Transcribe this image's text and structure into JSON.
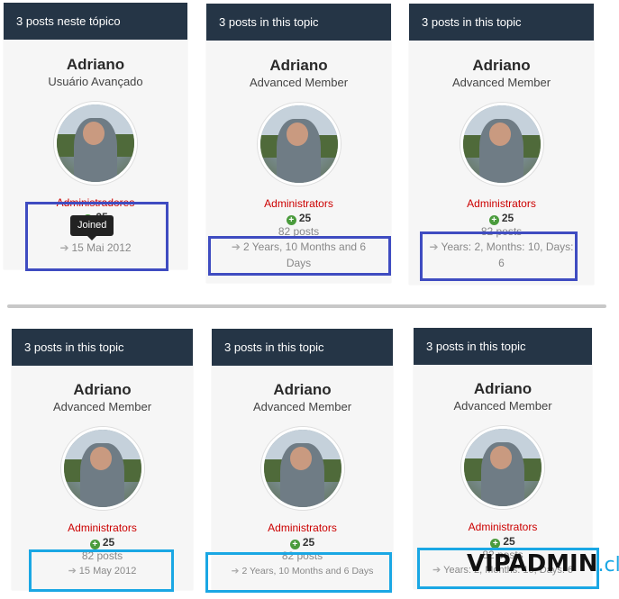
{
  "cards": [
    {
      "header": "3 posts neste tópico",
      "name": "Adriano",
      "rank": "Usuário Avançado",
      "group": "Administradores",
      "reputation": "25",
      "posts": "",
      "joined": "15 Mai 2012",
      "tooltip": "Joined"
    },
    {
      "header": "3 posts in this topic",
      "name": "Adriano",
      "rank": "Advanced Member",
      "group": "Administrators",
      "reputation": "25",
      "posts": "82 posts",
      "joined": "2 Years, 10 Months and 6 Days"
    },
    {
      "header": "3 posts in this topic",
      "name": "Adriano",
      "rank": "Advanced Member",
      "group": "Administrators",
      "reputation": "25",
      "posts": "82 posts",
      "joined": "Years: 2, Months: 10, Days: 6"
    },
    {
      "header": "3 posts in this topic",
      "name": "Adriano",
      "rank": "Advanced Member",
      "group": "Administrators",
      "reputation": "25",
      "posts": "82 posts",
      "joined": "15 May 2012"
    },
    {
      "header": "3 posts in this topic",
      "name": "Adriano",
      "rank": "Advanced Member",
      "group": "Administrators",
      "reputation": "25",
      "posts": "82 posts",
      "joined": "2 Years, 10 Months and 6 Days"
    },
    {
      "header": "3 posts in this topic",
      "name": "Adriano",
      "rank": "Advanced Member",
      "group": "Administrators",
      "reputation": "25",
      "posts": "82 posts",
      "joined": "Years: 2, Months: 10, Days: 6"
    }
  ],
  "watermark": {
    "main": "VIPADMIN",
    "suffix": ".club"
  },
  "colors": {
    "header": "#253546",
    "group": "#cc0000",
    "highlight_top": "#3f4cc1",
    "highlight_bottom": "#1aa7e4"
  },
  "icons": {
    "reputation": "plus-circle-icon",
    "joined": "sign-in-icon"
  }
}
